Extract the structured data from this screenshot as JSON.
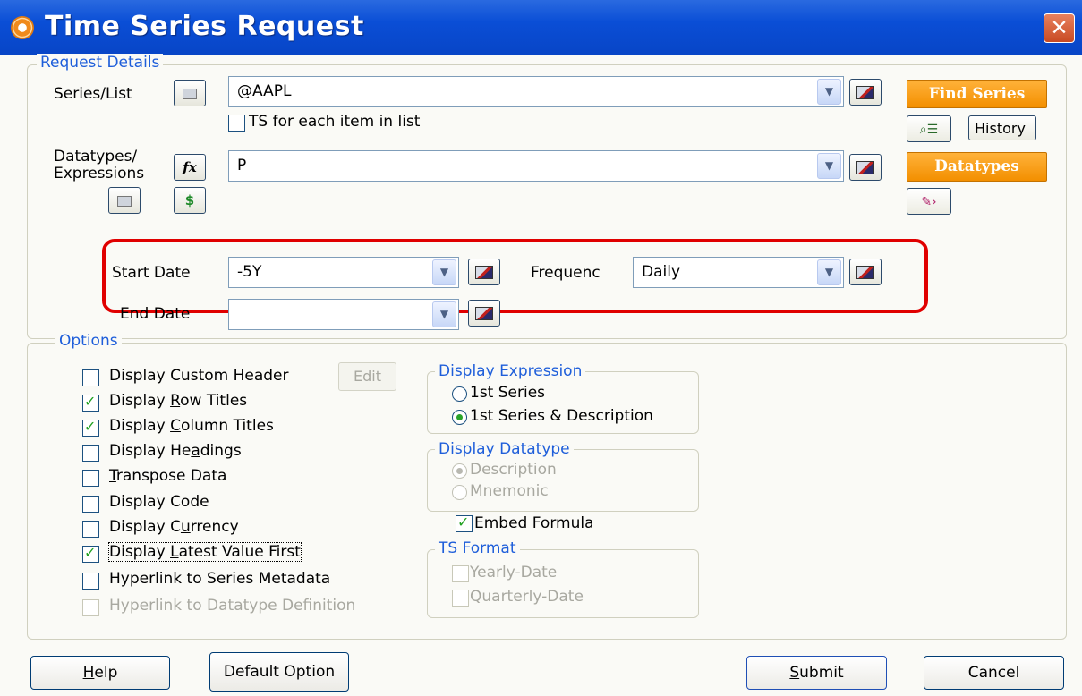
{
  "window": {
    "title": "Time Series Request",
    "close_glyph": "✕"
  },
  "request_details": {
    "legend": "Request Details",
    "series_label": "Series/List",
    "series_value": "@AAPL",
    "ts_each_label": "TS for each item in list",
    "datatypes_label_1": "Datatypes/",
    "datatypes_label_2": "Expressions",
    "datatypes_value": "P",
    "find_series_label": "Find Series",
    "history_label": "History",
    "datatypes_button_label": "Datatypes",
    "fx_glyph": "fx",
    "dollar_glyph": "$",
    "start_date_label": "Start Date",
    "start_date_value": "-5Y",
    "frequency_label": "Frequenc",
    "frequency_value": "Daily",
    "end_date_label": "End Date",
    "end_date_value": ""
  },
  "options": {
    "legend": "Options",
    "edit_label": "Edit",
    "checkboxes": [
      {
        "label": "Display Custom Header",
        "checked": false,
        "disabled": false
      },
      {
        "label_pre": "Display ",
        "label_u": "R",
        "label_post": "ow Titles",
        "checked": true
      },
      {
        "label_pre": "Display ",
        "label_u": "C",
        "label_post": "olumn Titles",
        "checked": true
      },
      {
        "label_pre": "Display He",
        "label_u": "a",
        "label_post": "dings",
        "checked": false
      },
      {
        "label_pre": "",
        "label_u": "T",
        "label_post": "ranspose Data",
        "checked": false
      },
      {
        "label": "Display Code",
        "checked": false
      },
      {
        "label_pre": "Display C",
        "label_u": "u",
        "label_post": "rrency",
        "checked": false
      },
      {
        "label_pre": "Display ",
        "label_u": "L",
        "label_post": "atest Value First",
        "checked": true
      },
      {
        "label": "Hyperlink to Series Metadata",
        "checked": false
      },
      {
        "label": "Hyperlink to Datatype Definition",
        "checked": false,
        "disabled": true
      }
    ],
    "display_expression": {
      "legend": "Display Expression",
      "options": [
        "1st Series",
        "1st Series & Description"
      ],
      "selected": 1
    },
    "display_datatype": {
      "legend": "Display Datatype",
      "options": [
        "Description",
        "Mnemonic"
      ],
      "selected": 0
    },
    "embed_formula_label": "Embed Formula",
    "embed_formula_checked": true,
    "ts_format": {
      "legend": "TS Format",
      "options": [
        "Yearly-Date",
        "Quarterly-Date"
      ]
    }
  },
  "buttons": {
    "help_u": "H",
    "help_rest": "elp",
    "default_option": "Default Option",
    "submit_u": "S",
    "submit_rest": "ubmit",
    "cancel": "Cancel"
  }
}
